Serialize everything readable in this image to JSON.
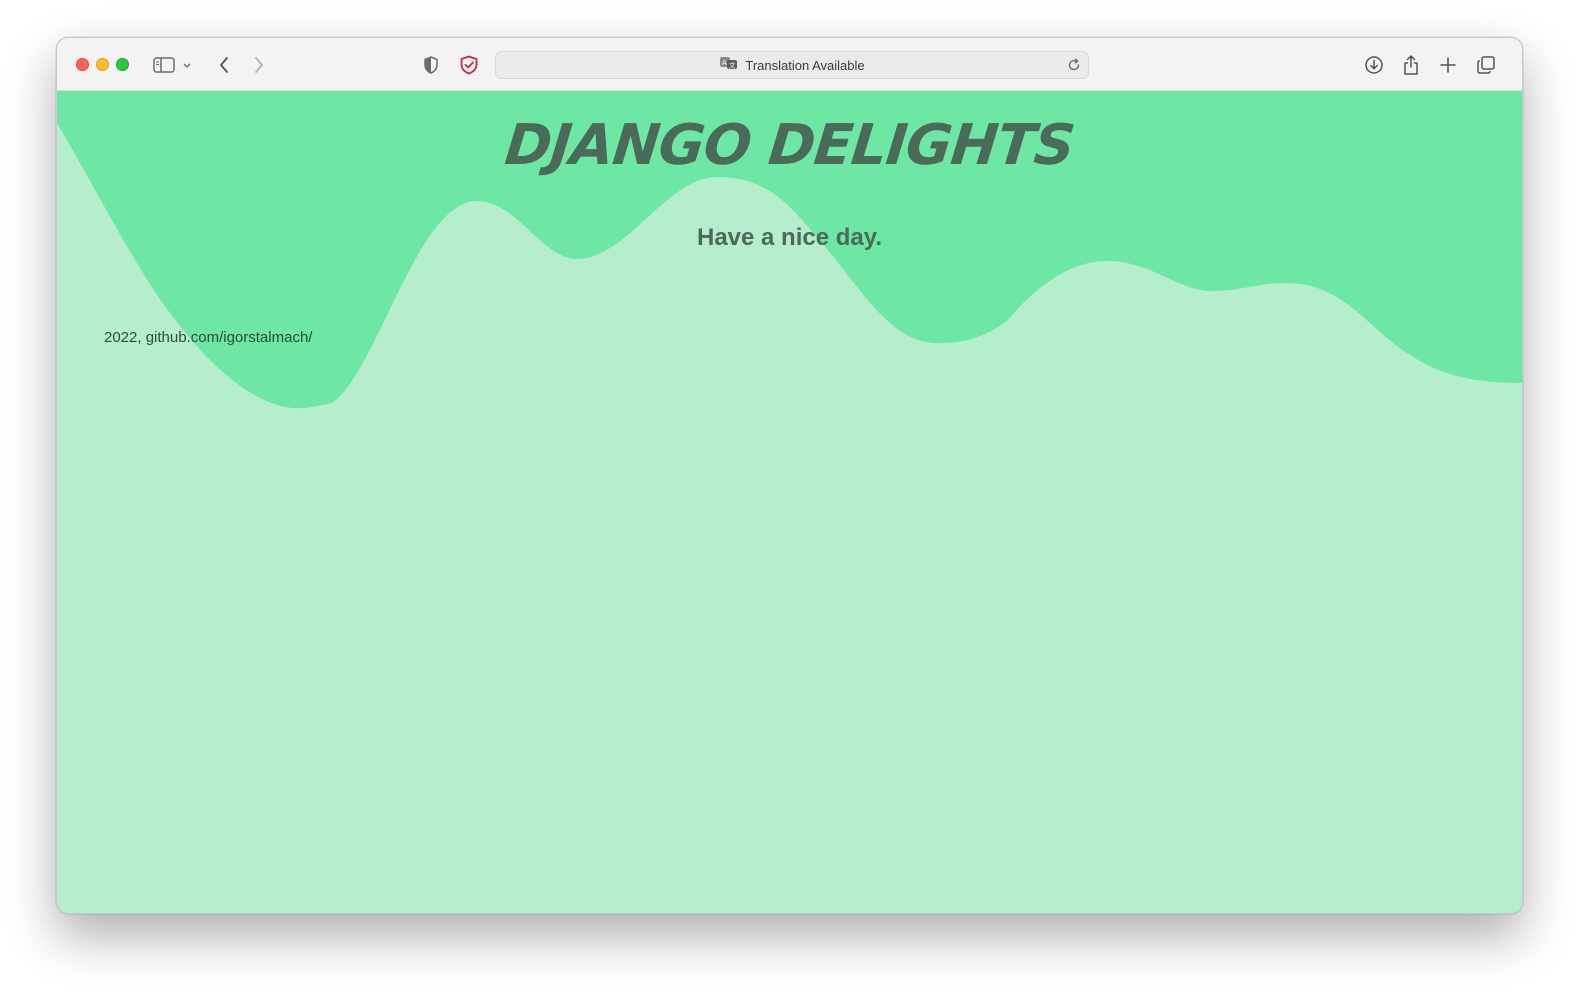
{
  "browser": {
    "address_bar_text": "Translation Available",
    "icons": {
      "sidebar": "sidebar-icon",
      "back": "chevron-left-icon",
      "forward": "chevron-right-icon",
      "privacy": "shield-half-icon",
      "extension": "shield-check-icon",
      "translate": "translate-icon",
      "reload": "reload-icon",
      "download": "download-icon",
      "share": "share-icon",
      "new_tab": "plus-icon",
      "tabs": "tab-overview-icon"
    }
  },
  "page": {
    "title": "DJANGO DELIGHTS",
    "tagline": "Have a nice day.",
    "footer": "2022, github.com/igorstalmach/"
  },
  "colors": {
    "header_green": "#6ee7a4",
    "page_green": "#b5edcd",
    "text_dark_green": "#4b6b5a"
  }
}
